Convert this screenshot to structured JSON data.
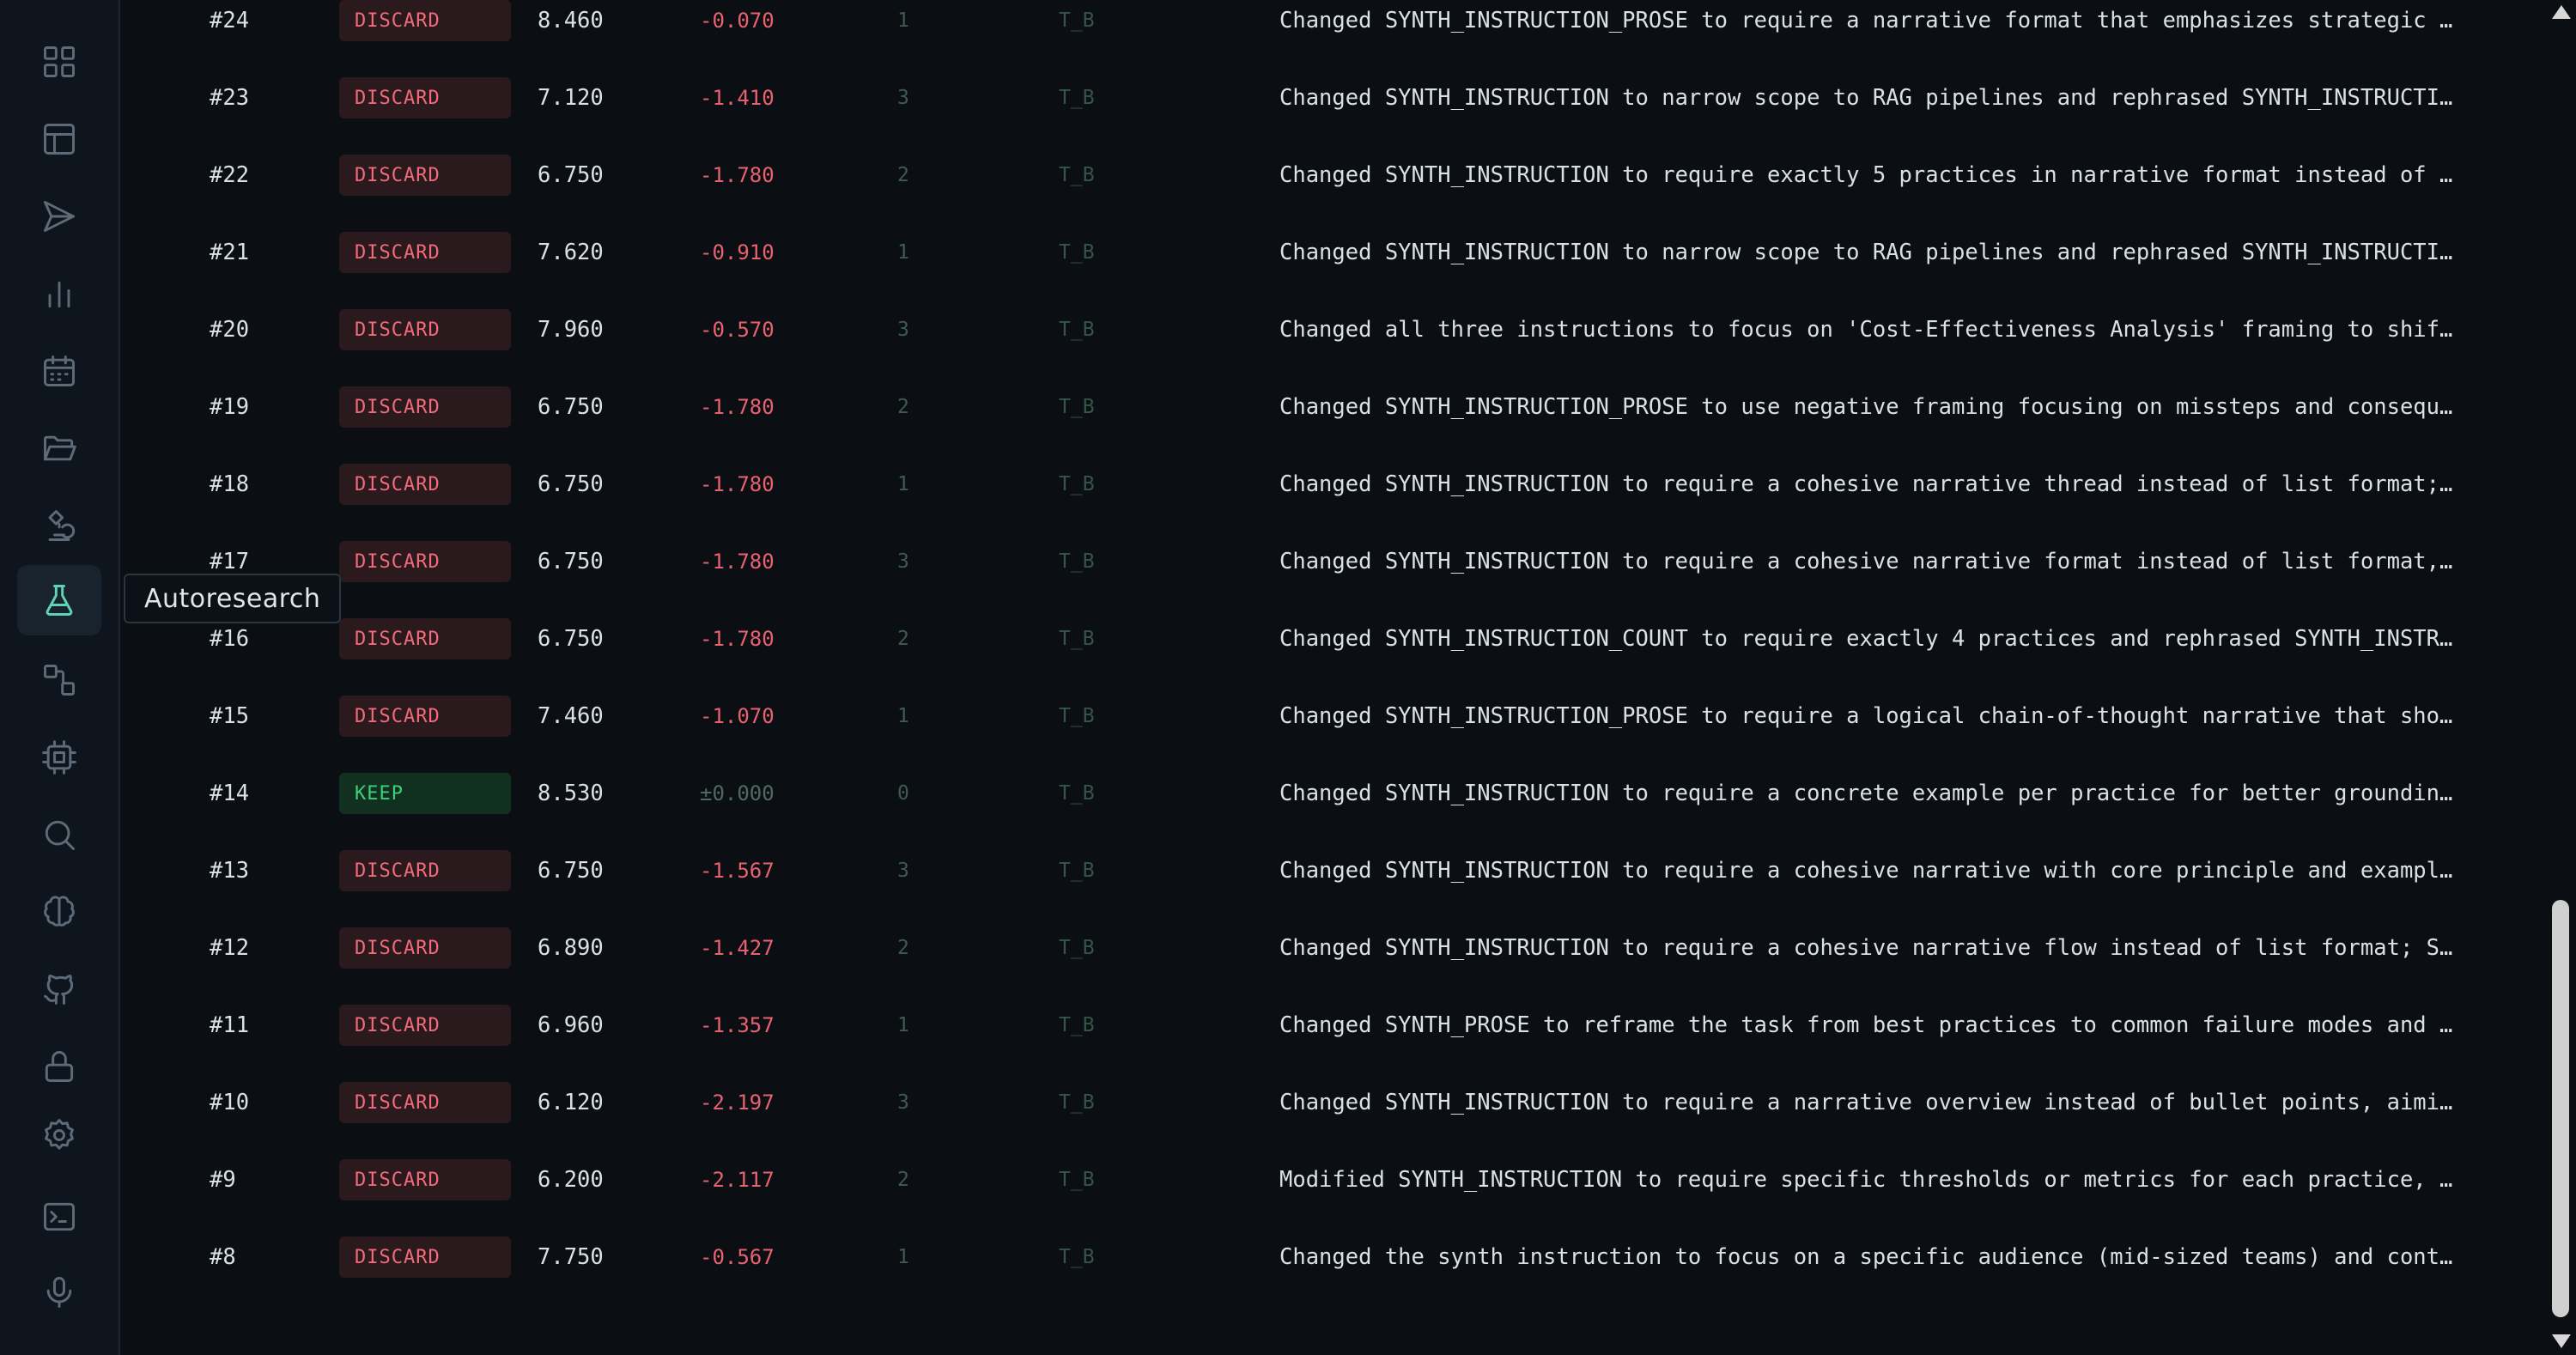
{
  "tooltip": "Autoresearch",
  "sidebar": {
    "items": [
      {
        "icon": "dashboard-icon"
      },
      {
        "icon": "table-icon"
      },
      {
        "icon": "send-icon"
      },
      {
        "icon": "bar-chart-icon"
      },
      {
        "icon": "calendar-icon"
      },
      {
        "icon": "folder-open-icon"
      },
      {
        "icon": "microscope-icon"
      },
      {
        "icon": "flask-icon",
        "active": true
      },
      {
        "icon": "workflow-icon"
      },
      {
        "icon": "chip-icon"
      },
      {
        "icon": "search-icon"
      },
      {
        "icon": "brain-icon"
      },
      {
        "icon": "github-icon"
      },
      {
        "icon": "lock-icon"
      },
      {
        "icon": "gear-icon"
      },
      {
        "icon": "terminal-icon"
      },
      {
        "icon": "microphone-icon"
      }
    ]
  },
  "rows": [
    {
      "id": "#24",
      "status": "DISCARD",
      "score": "8.460",
      "delta": "-0.070",
      "n": "1",
      "tag": "T_B",
      "desc": "Changed SYNTH_INSTRUCTION_PROSE to require a narrative format that emphasizes strategic tensions a…"
    },
    {
      "id": "#23",
      "status": "DISCARD",
      "score": "7.120",
      "delta": "-1.410",
      "n": "3",
      "tag": "T_B",
      "desc": "Changed SYNTH_INSTRUCTION to narrow scope to RAG pipelines and rephrased SYNTH_INSTRUCTION_PROSE t…"
    },
    {
      "id": "#22",
      "status": "DISCARD",
      "score": "6.750",
      "delta": "-1.780",
      "n": "2",
      "tag": "T_B",
      "desc": "Changed SYNTH_INSTRUCTION to require exactly 5 practices in narrative format instead of list, and …"
    },
    {
      "id": "#21",
      "status": "DISCARD",
      "score": "7.620",
      "delta": "-0.910",
      "n": "1",
      "tag": "T_B",
      "desc": "Changed SYNTH_INSTRUCTION to narrow scope to RAG pipelines and rephrased SYNTH_INSTRUCTION_PROSE t…"
    },
    {
      "id": "#20",
      "status": "DISCARD",
      "score": "7.960",
      "delta": "-0.570",
      "n": "3",
      "tag": "T_B",
      "desc": "Changed all three instructions to focus on 'Cost-Effectiveness Analysis' framing to shift away fro…"
    },
    {
      "id": "#19",
      "status": "DISCARD",
      "score": "6.750",
      "delta": "-1.780",
      "n": "2",
      "tag": "T_B",
      "desc": "Changed SYNTH_INSTRUCTION_PROSE to use negative framing focusing on missteps and consequences, and…"
    },
    {
      "id": "#18",
      "status": "DISCARD",
      "score": "6.750",
      "delta": "-1.780",
      "n": "1",
      "tag": "T_B",
      "desc": "Changed SYNTH_INSTRUCTION to require a cohesive narrative thread instead of list format; changed S…"
    },
    {
      "id": "#17",
      "status": "DISCARD",
      "score": "6.750",
      "delta": "-1.780",
      "n": "3",
      "tag": "T_B",
      "desc": "Changed SYNTH_INSTRUCTION to require a cohesive narrative format instead of list format, and updat…"
    },
    {
      "id": "#16",
      "status": "DISCARD",
      "score": "6.750",
      "delta": "-1.780",
      "n": "2",
      "tag": "T_B",
      "desc": "Changed SYNTH_INSTRUCTION_COUNT to require exactly 4 practices and rephrased SYNTH_INSTRUCTION_PRO…"
    },
    {
      "id": "#15",
      "status": "DISCARD",
      "score": "7.460",
      "delta": "-1.070",
      "n": "1",
      "tag": "T_B",
      "desc": "Changed SYNTH_INSTRUCTION_PROSE to require a logical chain-of-thought narrative that shows cause-a…"
    },
    {
      "id": "#14",
      "status": "KEEP",
      "score": "8.530",
      "delta": "±0.000",
      "n": "0",
      "tag": "T_B",
      "desc": "Changed SYNTH_INSTRUCTION to require a concrete example per practice for better grounding, SYNTH_I…"
    },
    {
      "id": "#13",
      "status": "DISCARD",
      "score": "6.750",
      "delta": "-1.567",
      "n": "3",
      "tag": "T_B",
      "desc": "Changed SYNTH_INSTRUCTION to require a cohesive narrative with core principle and examples; SYNTH_…"
    },
    {
      "id": "#12",
      "status": "DISCARD",
      "score": "6.890",
      "delta": "-1.427",
      "n": "2",
      "tag": "T_B",
      "desc": "Changed SYNTH_INSTRUCTION to require a cohesive narrative flow instead of list format; SYNTH_INSTR…"
    },
    {
      "id": "#11",
      "status": "DISCARD",
      "score": "6.960",
      "delta": "-1.357",
      "n": "1",
      "tag": "T_B",
      "desc": "Changed SYNTH_PROSE to reframe the task from best practices to common failure modes and their fixe…"
    },
    {
      "id": "#10",
      "status": "DISCARD",
      "score": "6.120",
      "delta": "-2.197",
      "n": "3",
      "tag": "T_B",
      "desc": "Changed SYNTH_INSTRUCTION to require a narrative overview instead of bullet points, aiming to impr…"
    },
    {
      "id": "#9",
      "status": "DISCARD",
      "score": "6.200",
      "delta": "-2.117",
      "n": "2",
      "tag": "T_B",
      "desc": "Modified SYNTH_INSTRUCTION to require specific thresholds or metrics for each practice, aiming to …"
    },
    {
      "id": "#8",
      "status": "DISCARD",
      "score": "7.750",
      "delta": "-0.567",
      "n": "1",
      "tag": "T_B",
      "desc": "Changed the synth instruction to focus on a specific audience (mid-sized teams) and context (cost-…"
    }
  ]
}
